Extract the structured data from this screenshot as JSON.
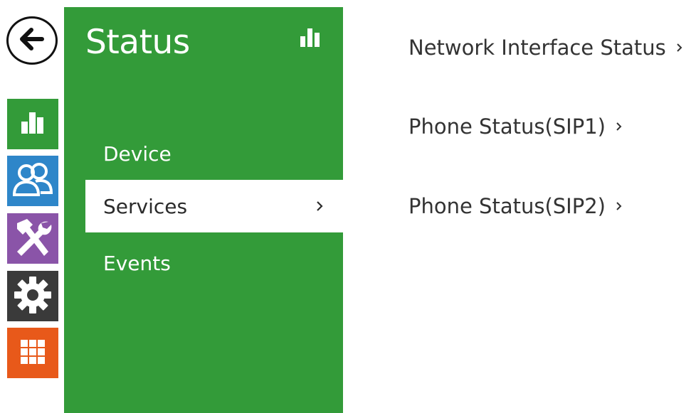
{
  "nav": {
    "back_icon": "back-arrow-icon",
    "rail": [
      {
        "name": "status",
        "icon": "bar-chart-icon",
        "color": "#339b39"
      },
      {
        "name": "directory",
        "icon": "users-icon",
        "color": "#2e86c9"
      },
      {
        "name": "hardware",
        "icon": "tools-icon",
        "color": "#8a54a8"
      },
      {
        "name": "system",
        "icon": "gear-icon",
        "color": "#3a3a3a"
      },
      {
        "name": "services",
        "icon": "grid-icon",
        "color": "#e8591a"
      }
    ]
  },
  "panel": {
    "title": "Status",
    "title_icon": "bar-chart-icon",
    "background": "#339b39",
    "menu": [
      {
        "label": "Device",
        "active": false
      },
      {
        "label": "Services",
        "active": true
      },
      {
        "label": "Events",
        "active": false
      }
    ]
  },
  "content": {
    "links": [
      {
        "label": "Network Interface Status"
      },
      {
        "label": "Phone Status(SIP1)"
      },
      {
        "label": "Phone Status(SIP2)"
      }
    ]
  }
}
